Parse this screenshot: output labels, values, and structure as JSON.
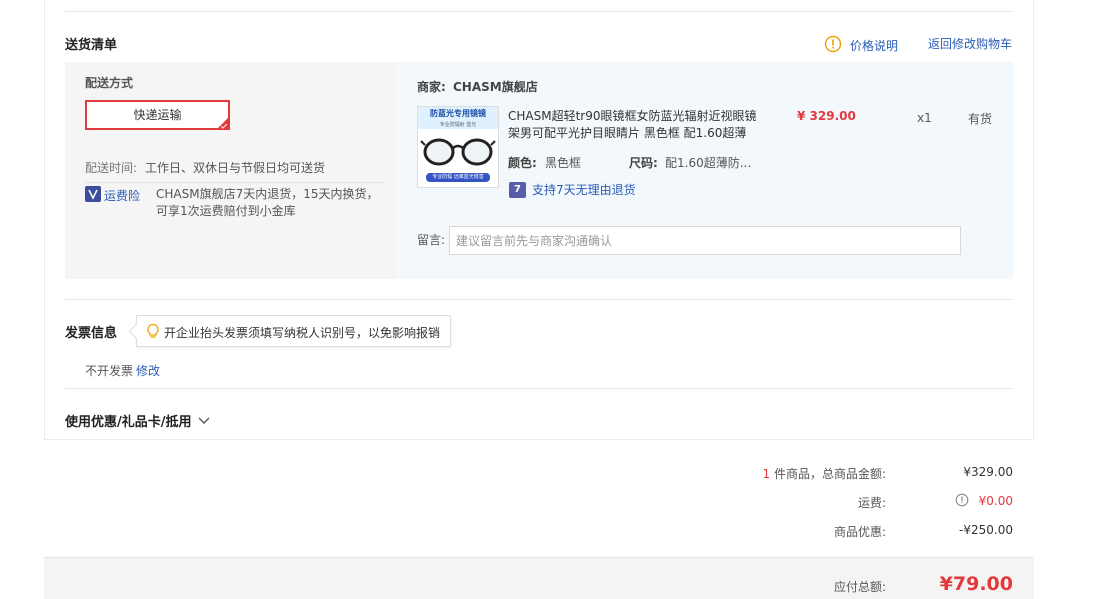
{
  "delivery_list": {
    "title": "送货清单",
    "price_note_label": "价格说明",
    "back_to_cart_label": "返回修改购物车",
    "shipping_method_label": "配送方式",
    "shipping_option": "快递运输",
    "delivery_time_label": "配送时间:",
    "delivery_time_value": "工作日、双休日与节假日均可送货",
    "insurance_label": "运费险",
    "insurance_line1": "CHASM旗舰店7天内退货，15天内换货，",
    "insurance_line2": "可享1次运费赔付到小金库",
    "merchant_label": "商家:",
    "merchant_name": "CHASM旗舰店",
    "product": {
      "thumb_banner": "防蓝光专用镜镜",
      "thumb_sub": "专业防辐射 蓝光",
      "thumb_footer": "专业防辐 远离蓝光侵害",
      "title_line1": "CHASM超轻tr90眼镜框女防蓝光辐射近视眼镜",
      "title_line2": "架男可配平光护目眼睛片 黑色框 配1.60超薄",
      "price": "¥ 329.00",
      "qty": "x1",
      "stock": "有货",
      "color_label": "颜色:",
      "color_value": "黑色框",
      "size_label": "尺码:",
      "size_value": "配1.60超薄防...",
      "return_badge": "7",
      "return_policy": "支持7天无理由退货"
    },
    "note_label": "留言:",
    "note_placeholder": "建议留言前先与商家沟通确认"
  },
  "invoice": {
    "title": "发票信息",
    "tooltip": "开企业抬头发票须填写纳税人识别号，以免影响报销",
    "status": "不开发票",
    "edit_label": "修改"
  },
  "discount": {
    "title": "使用优惠/礼品卡/抵用"
  },
  "summary": {
    "item_count": "1",
    "item_count_suffix": "件商品，总商品金额:",
    "item_total": "¥329.00",
    "shipping_label": "运费:",
    "shipping_value": "¥0.00",
    "discount_label": "商品优惠:",
    "discount_value": "-¥250.00",
    "payable_label": "应付总额:",
    "payable_value": "¥79.00"
  },
  "colors": {
    "accent_red": "#e4393c",
    "link_blue": "#2a5cb5",
    "warn_orange": "#f0a000"
  }
}
